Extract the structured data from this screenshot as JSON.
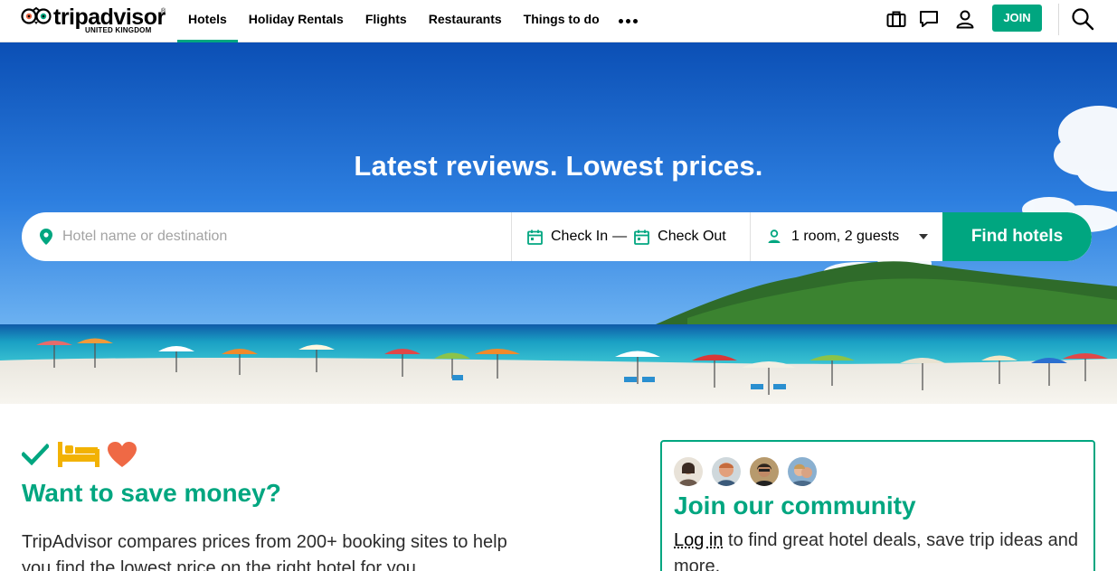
{
  "header": {
    "logo_text": "tripadvisor",
    "logo_sub": "UNITED KINGDOM",
    "logo_reg": "®",
    "nav": [
      {
        "label": "Hotels",
        "active": true
      },
      {
        "label": "Holiday Rentals",
        "active": false
      },
      {
        "label": "Flights",
        "active": false
      },
      {
        "label": "Restaurants",
        "active": false
      },
      {
        "label": "Things to do",
        "active": false
      }
    ],
    "more_icon": "more-dots-icon",
    "icons": [
      "trips-suitcase-icon",
      "messages-icon",
      "profile-icon",
      "search-icon"
    ],
    "join_label": "JOIN"
  },
  "hero": {
    "title": "Latest reviews. Lowest prices.",
    "destination_placeholder": "Hotel name or destination",
    "check_in": "Check In",
    "dash": "—",
    "check_out": "Check Out",
    "guests": "1 room, 2 guests",
    "find_label": "Find hotels"
  },
  "promo": {
    "icons": [
      "checkmark-icon",
      "bed-icon",
      "heart-icon"
    ],
    "title": "Want to save money?",
    "text": "TripAdvisor compares prices from 200+ booking sites to help you find the lowest price on the right hotel for you."
  },
  "community": {
    "title": "Join our community",
    "login_label": "Log in",
    "text": " to find great hotel deals, save trip ideas and more."
  },
  "colors": {
    "brand_green": "#00a680",
    "promo_bed": "#f2b203",
    "promo_heart": "#ef6945"
  }
}
